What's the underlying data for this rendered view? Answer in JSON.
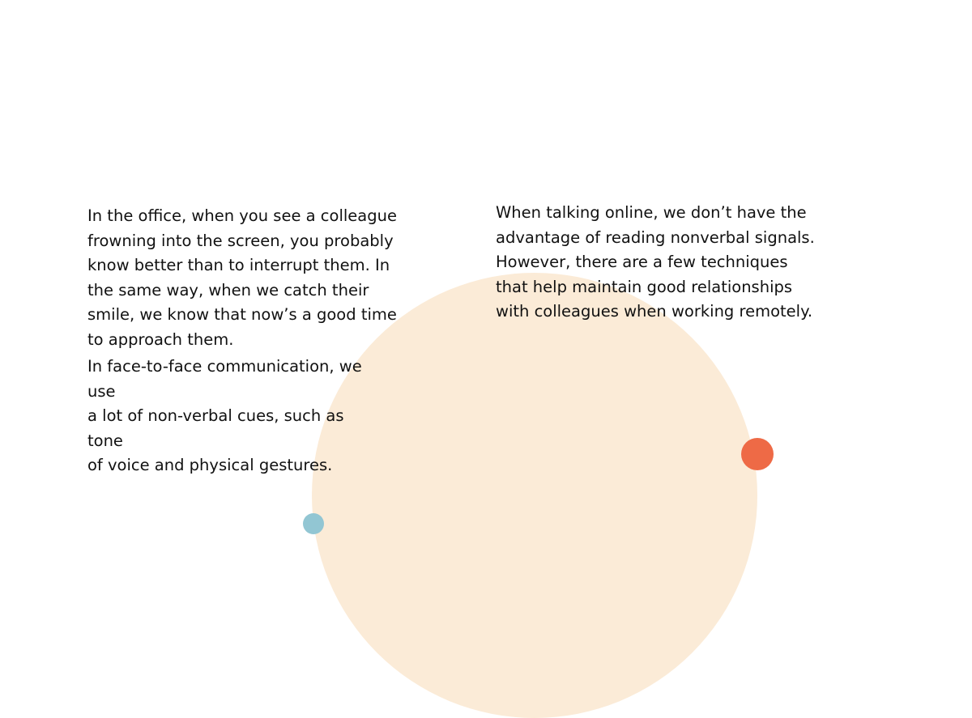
{
  "slide": {
    "left_paragraph_1": "In the office, when you see a colleague\nfrowning into the screen, you probably\nknow better than to interrupt them. In\nthe same way, when we catch their\nsmile, we know that now’s a good time\nto approach them.",
    "left_paragraph_2": "In face-to-face communication, we\nuse\na lot of non-verbal cues, such as\ntone\nof voice and physical gestures.",
    "right_paragraph": "When talking online, we don’t have the\nadvantage of reading nonverbal signals.\nHowever, there are a few techniques\nthat help maintain good relationships\nwith colleagues when working remotely."
  },
  "colors": {
    "big_circle": "#FBEBD7",
    "orange_dot": "#EE6A46",
    "blue_dot": "#92C6D3"
  }
}
